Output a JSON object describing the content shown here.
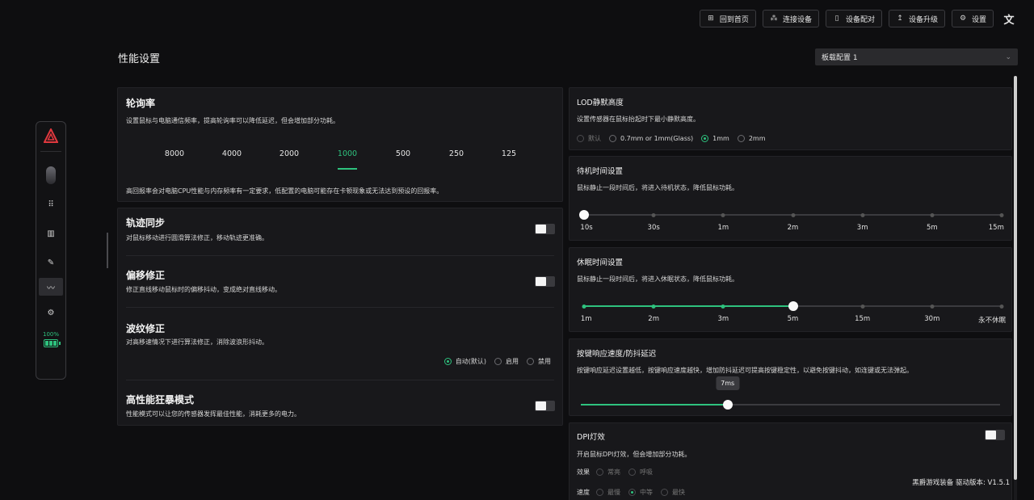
{
  "topbar": {
    "home": "回到首页",
    "connect": "连接设备",
    "pair": "设备配对",
    "upgrade": "设备升级",
    "settings": "设置"
  },
  "page": {
    "title": "性能设置"
  },
  "config_select": {
    "value": "板载配置 1"
  },
  "sidebar": {
    "battery": "100%"
  },
  "polling": {
    "title": "轮询率",
    "desc": "设置鼠标与电脑通信频率，提高轮询率可以降低延迟，但会增加部分功耗。",
    "rates": [
      "8000",
      "4000",
      "2000",
      "1000",
      "500",
      "250",
      "125"
    ],
    "selected": "1000",
    "note": "高回报率会对电脑CPU性能与内存频率有一定要求，低配置的电脑可能存在卡顿现象或无法达到预设的回报率。"
  },
  "track_sync": {
    "title": "轨迹同步",
    "desc": "对鼠标移动进行圆滑算法修正，移动轨迹更准确。",
    "enabled": false
  },
  "offset_fix": {
    "title": "偏移修正",
    "desc": "修正直线移动鼠标时的偏移抖动，变成绝对直线移动。",
    "enabled": false
  },
  "ripple_fix": {
    "title": "波纹修正",
    "desc": "对高移速情况下进行算法修正，消除波浪形抖动。",
    "options": [
      "自动(默认)",
      "启用",
      "禁用"
    ],
    "selected": "自动(默认)"
  },
  "high_perf": {
    "title": "高性能狂暴模式",
    "desc": "性能模式可以让您的传感器发挥最佳性能，消耗更多的电力。",
    "enabled": false
  },
  "lod": {
    "title": "LOD静默高度",
    "desc": "设置传感器在鼠标抬起时下最小静默高度。",
    "options": [
      "默认",
      "0.7mm or 1mm(Glass)",
      "1mm",
      "2mm"
    ],
    "selected": "1mm"
  },
  "standby": {
    "title": "待机时间设置",
    "desc": "鼠标静止一段时间后，将进入待机状态，降低鼠标功耗。",
    "stops": [
      "10s",
      "30s",
      "1m",
      "2m",
      "3m",
      "5m",
      "15m"
    ],
    "selected_index": 0
  },
  "sleep": {
    "title": "休眠时间设置",
    "desc": "鼠标静止一段时间后，将进入休眠状态，降低鼠标功耗。",
    "stops": [
      "1m",
      "2m",
      "3m",
      "5m",
      "15m",
      "30m",
      "永不休眠"
    ],
    "selected_index": 3
  },
  "debounce": {
    "title": "按键响应速度/防抖延迟",
    "desc": "按键响应延迟设置越低，按键响应速度越快，增加防抖延迟可提高按键稳定性，以避免按键抖动，如连键或无法弹起。",
    "value": "7ms",
    "fraction": 0.35
  },
  "dpi_light": {
    "title": "DPI灯效",
    "desc": "开启鼠标DPI灯效，但会增加部分功耗。",
    "enabled": false,
    "effect_label": "效果",
    "effect_options": [
      "常亮",
      "呼吸"
    ],
    "speed_label": "速度",
    "speed_options": [
      "最慢",
      "中等",
      "最快"
    ],
    "speed_selected": "中等"
  },
  "footer": {
    "version": "黑爵游戏装备 驱动版本: V1.5.1"
  },
  "colors": {
    "accent": "#2ec27e",
    "logo": "#e0383e",
    "background": "#0e0e10",
    "card": "#18181b"
  }
}
